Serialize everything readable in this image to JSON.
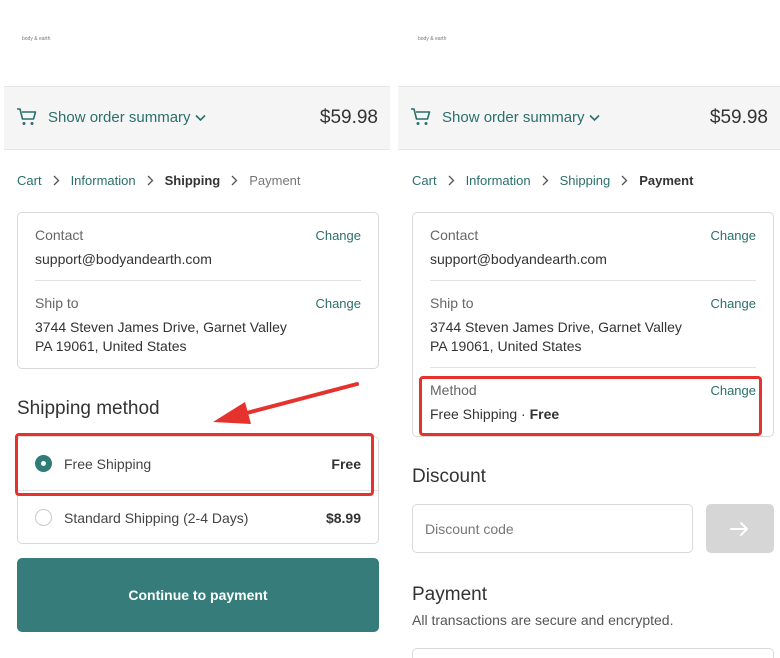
{
  "store": {
    "logo_text": "body & earth"
  },
  "header": {
    "summary_toggle": "Show order summary",
    "total": "$59.98"
  },
  "left": {
    "breadcrumb": {
      "cart": "Cart",
      "information": "Information",
      "shipping": "Shipping",
      "payment": "Payment"
    },
    "review": {
      "contact_label": "Contact",
      "contact_value": "support@bodyandearth.com",
      "contact_change": "Change",
      "shipto_label": "Ship to",
      "shipto_line1": "3744 Steven James Drive, Garnet Valley",
      "shipto_line2": "PA 19061, United States",
      "shipto_change": "Change"
    },
    "shipping_method": {
      "title": "Shipping method",
      "options": [
        {
          "name": "Free Shipping",
          "price": "Free",
          "selected": true
        },
        {
          "name": "Standard Shipping (2-4 Days)",
          "price": "$8.99",
          "selected": false
        }
      ]
    },
    "continue_label": "Continue to payment"
  },
  "right": {
    "breadcrumb": {
      "cart": "Cart",
      "information": "Information",
      "shipping": "Shipping",
      "payment": "Payment"
    },
    "review": {
      "contact_label": "Contact",
      "contact_value": "support@bodyandearth.com",
      "contact_change": "Change",
      "shipto_label": "Ship to",
      "shipto_line1": "3744 Steven James Drive, Garnet Valley",
      "shipto_line2": "PA 19061, United States",
      "shipto_change": "Change",
      "method_label": "Method",
      "method_value": "Free Shipping · ",
      "method_price": "Free",
      "method_change": "Change"
    },
    "discount": {
      "title": "Discount",
      "placeholder": "Discount code"
    },
    "payment": {
      "title": "Payment",
      "subtitle": "All transactions are secure and encrypted."
    }
  },
  "colors": {
    "accent": "#2a6f6c",
    "button": "#357c7a",
    "annotation": "#e5322c"
  }
}
